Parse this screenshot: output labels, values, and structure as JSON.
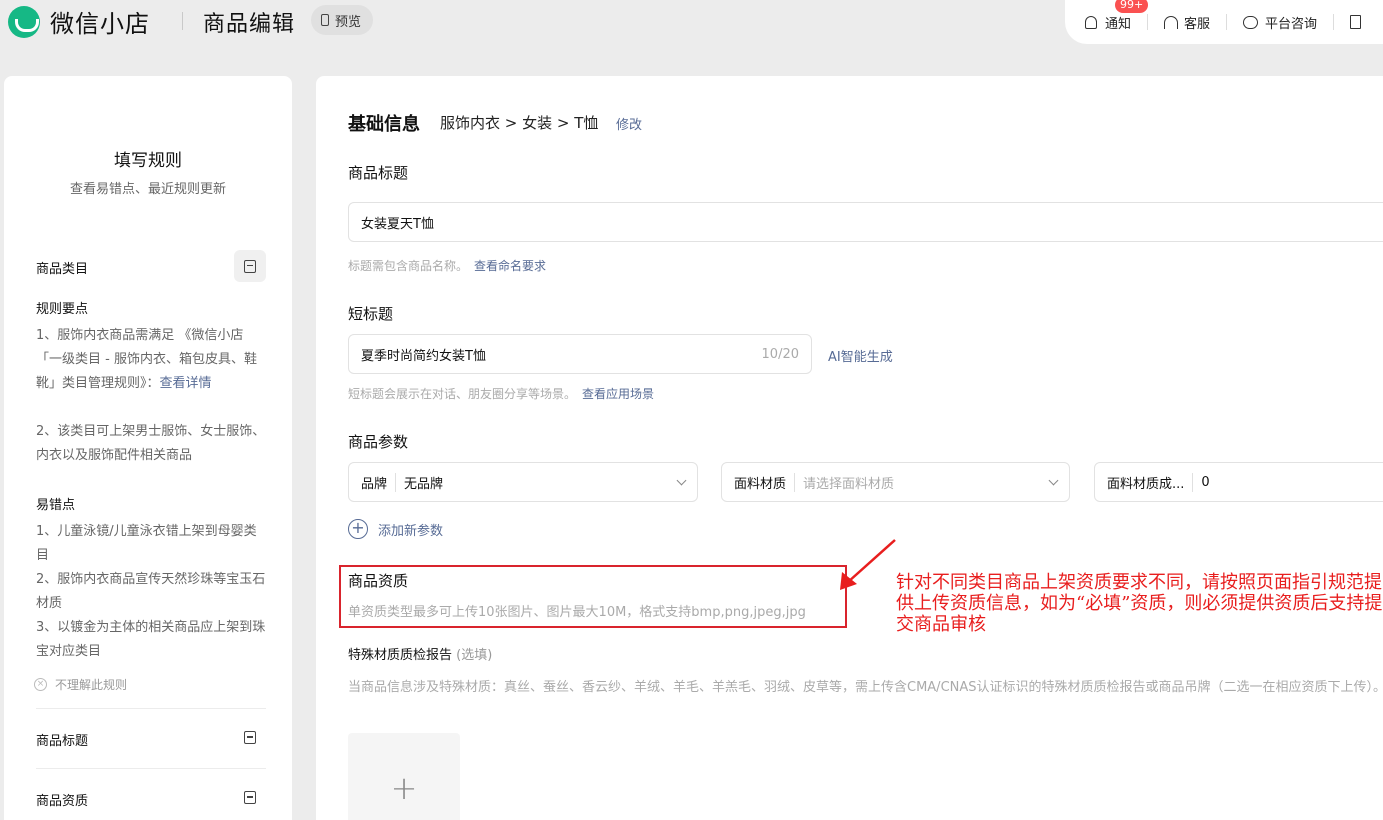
{
  "header": {
    "brand": "微信小店",
    "page_title": "商品编辑",
    "preview_label": "预览",
    "notify_label": "通知",
    "notify_badge": "99+",
    "service_label": "客服",
    "consult_label": "平台咨询"
  },
  "rules": {
    "title": "填写规则",
    "subtitle": "查看易错点、最近规则更新",
    "category_head": "商品类目",
    "key_points_head": "规则要点",
    "key_point_1": "1、服饰内衣商品需满足 《微信小店「一级类目 - 服饰内衣、箱包皮具、鞋靴」类目管理规则》：",
    "key_point_1_link": "查看详情",
    "key_point_2": "2、该类目可上架男士服饰、女士服饰、内衣以及服饰配件相关商品",
    "mistakes_head": "易错点",
    "mistake_1": "1、儿童泳镜/儿童泳衣错上架到母婴类目",
    "mistake_2": "2、服饰内衣商品宣传天然珍珠等宝玉石材质",
    "mistake_3": "3、以镀金为主体的相关商品应上架到珠宝对应类目",
    "not_understand": "不理解此规则",
    "section_title_label": "商品标题",
    "section_qual_label": "商品资质"
  },
  "form": {
    "section_title": "基础信息",
    "breadcrumb": "服饰内衣 > 女装 > T恤",
    "modify": "修改",
    "title_label": "商品标题",
    "title_value": "女装夏天T恤",
    "title_hint": "标题需包含商品名称。",
    "title_hint_link": "查看命名要求",
    "short_label": "短标题",
    "short_value": "夏季时尚简约女装T恤",
    "short_counter": "10/20",
    "ai_generate": "AI智能生成",
    "short_hint": "短标题会展示在对话、朋友圈分享等场景。",
    "short_hint_link": "查看应用场景",
    "params_label": "商品参数",
    "param_brand_label": "品牌",
    "param_brand_value": "无品牌",
    "param_fabric_label": "面料材质",
    "param_fabric_placeholder": "请选择面料材质",
    "param_ratio_label": "面料材质成...",
    "param_ratio_value": "0",
    "add_param": "添加新参数",
    "qual_label": "商品资质",
    "qual_hint": "单资质类型最多可上传10张图片、图片最大10M，格式支持bmp,png,jpeg,jpg",
    "special_label": "特殊材质质检报告",
    "special_optional": "(选填)",
    "special_desc": "当商品信息涉及特殊材质：真丝、蚕丝、香云纱、羊绒、羊毛、羊羔毛、羽绒、皮草等，需上传含CMA/CNAS认证标识的特殊材质质检报告或商品吊牌（二选一在相应资质下上传）。",
    "upload_plus": "+"
  },
  "annotation": {
    "text": "针对不同类目商品上架资质要求不同，请按照页面指引规范提供上传资质信息，如为“必填”资质，则必须提供资质后支持提交商品审核"
  },
  "colors": {
    "brand_green": "#16b885",
    "link_blue": "#576b95",
    "annotation_red": "#e81e1e",
    "badge_red": "#fa5151"
  }
}
